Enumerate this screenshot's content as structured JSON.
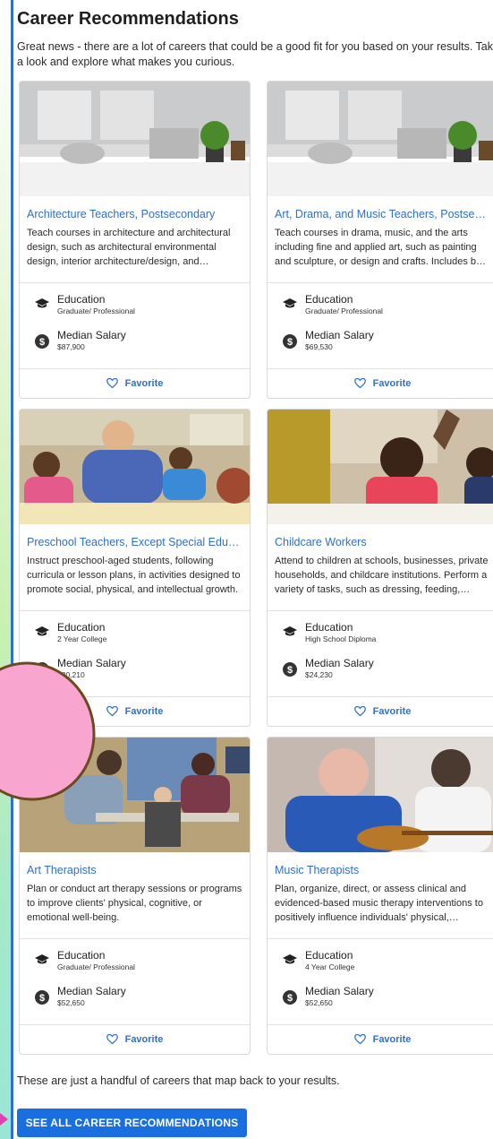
{
  "page": {
    "title": "Career Recommendations",
    "intro": "Great news - there are a lot of careers that could be a good fit for you based on your results. Take a look and explore what makes you curious.",
    "footer_text": "These are just a handful of careers that map back to your results.",
    "cta_label": "SEE ALL CAREER RECOMMENDATIONS"
  },
  "labels": {
    "education": "Education",
    "median_salary": "Median Salary",
    "favorite": "Favorite"
  },
  "icons": {
    "education": "graduation-cap-icon",
    "salary": "dollar-coin-icon",
    "favorite": "heart-outline-icon"
  },
  "colors": {
    "accent": "#2f6fcf",
    "cta": "#1a6fe0",
    "panel_border": "#2f6fcf"
  },
  "careers": [
    {
      "title": "Architecture Teachers, Postsecondary",
      "description": "Teach courses in architecture and architectural design, such as architectural environmental design, interior architecture/design, and landscape architecture.",
      "education": "Graduate/ Professional",
      "salary": "$87,900"
    },
    {
      "title": "Art, Drama, and Music Teachers, Postsecondary",
      "description": "Teach courses in drama, music, and the arts including fine and applied art, such as painting and sculpture, or design and crafts. Includes both teachers primarily engaged in teaching.",
      "education": "Graduate/ Professional",
      "salary": "$69,530"
    },
    {
      "title": "Preschool Teachers, Except Special Education",
      "description": "Instruct preschool-aged students, following curricula or lesson plans, in activities designed to promote social, physical, and intellectual growth.",
      "education": "2 Year College",
      "salary": "$30,210"
    },
    {
      "title": "Childcare Workers",
      "description": "Attend to children at schools, businesses, private households, and childcare institutions. Perform a variety of tasks, such as dressing, feeding, bathing, and overseeing play.",
      "education": "High School Diploma",
      "salary": "$24,230"
    },
    {
      "title": "Art Therapists",
      "description": "Plan or conduct art therapy sessions or programs to improve clients' physical, cognitive, or emotional well-being.",
      "education": "Graduate/ Professional",
      "salary": "$52,650"
    },
    {
      "title": "Music Therapists",
      "description": "Plan, organize, direct, or assess clinical and evidenced-based music therapy interventions to positively influence individuals' physical, psychological, cognitive, or behavioral status.",
      "education": "4 Year College",
      "salary": "$52,650"
    }
  ]
}
